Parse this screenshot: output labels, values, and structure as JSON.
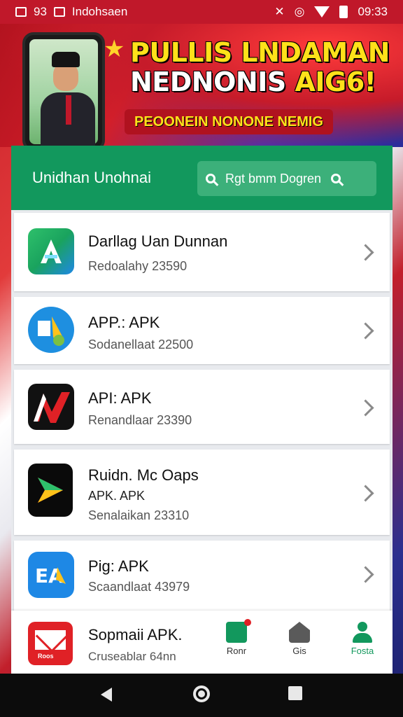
{
  "status_bar": {
    "carrier": "Indohsaen",
    "left_num": "93",
    "time": "09:33"
  },
  "banner": {
    "title_line1": "PULLIS LNDAMAN",
    "title_line2_white": "NEDNONIS ",
    "title_line2_yellow": "AIG6!",
    "subtitle": "PEOONEIN NONONE NEMIG"
  },
  "panel": {
    "title": "Unidhan Unohnai",
    "search_placeholder": "Rgt bmm Dogren"
  },
  "apps": [
    {
      "name": "Darllag Uan Dunnan",
      "sub": "",
      "meta": "Redoalahy 23590"
    },
    {
      "name": "APP.: APK",
      "sub": "",
      "meta": "Sodanellaat 22500"
    },
    {
      "name": "API: APK",
      "sub": "",
      "meta": "Renandlaar 23390"
    },
    {
      "name": "Ruidn. Mc Oaps",
      "sub": "APK. APK",
      "meta": "Senalaikan 23310"
    },
    {
      "name": "Pig: APK",
      "sub": "",
      "meta": "Scaandlaat 43979"
    }
  ],
  "bottom": {
    "app_name": "Sopmaii APK.",
    "app_meta": "Cruseablar 64nn",
    "badge": "Roos",
    "tabs": [
      "Ronr",
      "Gis",
      "Fosta"
    ]
  },
  "colors": {
    "accent": "#12985d",
    "status_bar": "#c0182a",
    "banner_yellow": "#ffe11a"
  }
}
